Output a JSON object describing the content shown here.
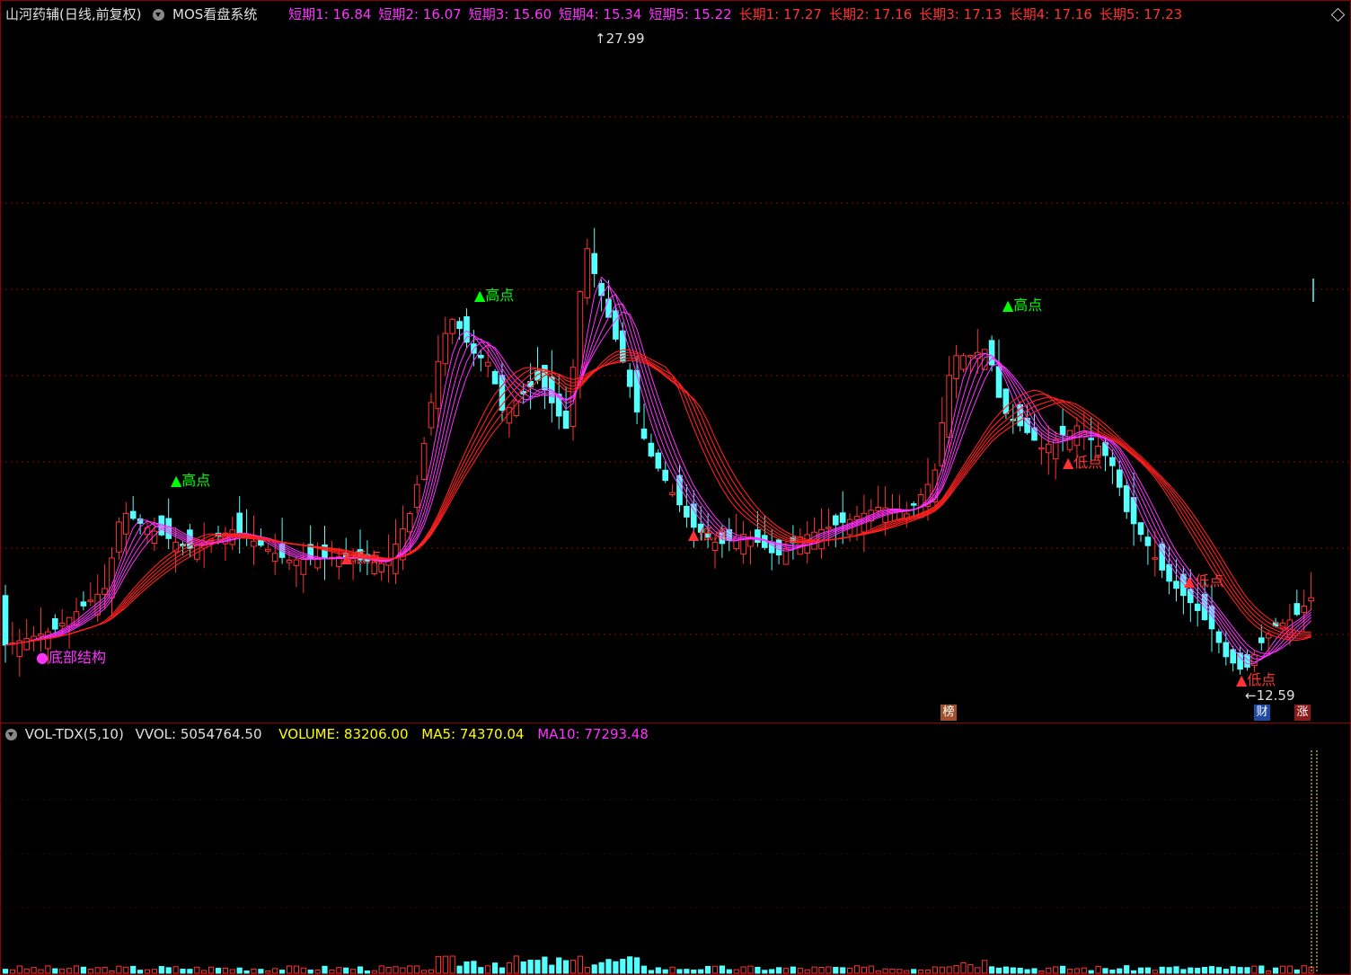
{
  "main_panel": {
    "stock_title": "山河药辅(日线,前复权)",
    "indicator_name": "MOS看盘系统",
    "legend": [
      {
        "label": "短期1: 16.84",
        "color": "#ff33ff"
      },
      {
        "label": "短期2: 16.07",
        "color": "#ff33ff"
      },
      {
        "label": "短期3: 15.60",
        "color": "#ff33ff"
      },
      {
        "label": "短期4: 15.34",
        "color": "#ff33ff"
      },
      {
        "label": "短期5: 15.22",
        "color": "#ff33ff"
      },
      {
        "label": "长期1: 17.27",
        "color": "#ff3333"
      },
      {
        "label": "长期2: 17.16",
        "color": "#ff3333"
      },
      {
        "label": "长期3: 17.13",
        "color": "#ff3333"
      },
      {
        "label": "长期4: 17.16",
        "color": "#ff3333"
      },
      {
        "label": "长期5: 17.23",
        "color": "#ff3333"
      }
    ],
    "annotations": {
      "high_price": "27.99",
      "low_price": "12.59",
      "bottom_structure": "●底部结构",
      "high_label": "▲高点",
      "low_label": "▲低点"
    },
    "badges": {
      "bang": "榜",
      "cai": "财",
      "zhang": "涨"
    }
  },
  "volume_panel": {
    "name": "VOL-TDX(5,10)",
    "vvol": "VVOL: 5054764.50",
    "volume": "VOLUME: 83206.00",
    "ma5": "MA5: 74370.04",
    "ma10": "MA10: 77293.48",
    "colors": {
      "vvol": "#e0e0e0",
      "volume": "#ffff00",
      "ma5": "#ffff00",
      "ma10": "#ff33ff"
    }
  },
  "colors": {
    "up": "#ff3333",
    "down": "#54ffff",
    "short_ma": "#ff33ff",
    "long_ma": "#ff2020",
    "grid": "#8b0000"
  }
}
